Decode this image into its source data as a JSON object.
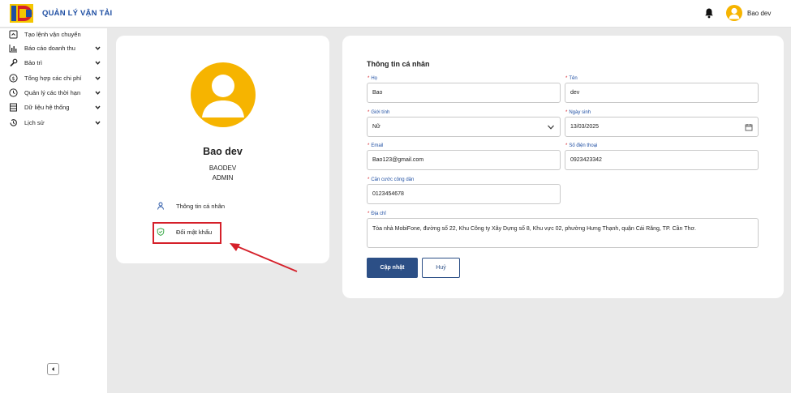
{
  "header": {
    "app_title": "QUẢN LÝ VẬN TẢI",
    "user_name": "Bao dev",
    "logo_icon": "company-logo",
    "bell_icon": "bell-icon"
  },
  "sidebar": {
    "items": [
      {
        "label": "Tạo lệnh vận chuyển",
        "icon": "square-arrow-icon",
        "expandable": false
      },
      {
        "label": "Báo cáo doanh thu",
        "icon": "bar-chart-icon",
        "expandable": true
      },
      {
        "label": "Bảo trì",
        "icon": "wrench-icon",
        "expandable": true
      },
      {
        "label": "Tổng hợp các chi phí",
        "icon": "dollar-circle-icon",
        "expandable": true
      },
      {
        "label": "Quản lý các thời hạn",
        "icon": "clock-icon",
        "expandable": true
      },
      {
        "label": "Dữ liệu hệ thống",
        "icon": "database-icon",
        "expandable": true
      },
      {
        "label": "Lịch sử",
        "icon": "history-icon",
        "expandable": true
      }
    ],
    "collapse_icon": "chevron-left-icon"
  },
  "profile": {
    "name": "Bao dev",
    "username": "BAODEV",
    "role": "ADMIN",
    "menu": [
      {
        "label": "Thông tin cá nhân",
        "icon": "user-icon"
      },
      {
        "label": "Đổi mật khẩu",
        "icon": "shield-check-icon"
      }
    ]
  },
  "form": {
    "title": "Thông tin cá nhân",
    "fields": {
      "last_name": {
        "label": "Họ",
        "value": "Bao",
        "required": true
      },
      "first_name": {
        "label": "Tên",
        "value": "dev",
        "required": true
      },
      "gender": {
        "label": "Giới tính",
        "value": "Nữ",
        "required": true
      },
      "birthday": {
        "label": "Ngày sinh",
        "value": "13/03/2025",
        "required": true
      },
      "email": {
        "label": "Email",
        "value": "Bao123@gmail.com",
        "required": true
      },
      "phone": {
        "label": "Số điện thoại",
        "value": "0923423342",
        "required": true
      },
      "id_card": {
        "label": "Căn cước công dân",
        "value": "0123454678",
        "required": true
      },
      "address": {
        "label": "Địa chỉ",
        "value": "Tòa nhà MobiFone, đường số 22, Khu Công ty Xây Dựng số 8, Khu vực 02, phường Hưng Thạnh, quận Cái Răng, TP. Cần Thơ.",
        "required": true
      }
    },
    "buttons": {
      "submit": "Cập nhật",
      "cancel": "Huỷ"
    }
  },
  "colors": {
    "brand_blue": "#1f4fa3",
    "primary_button": "#2c4f86",
    "avatar_yellow": "#f6b400",
    "annotation_red": "#d5202a"
  }
}
